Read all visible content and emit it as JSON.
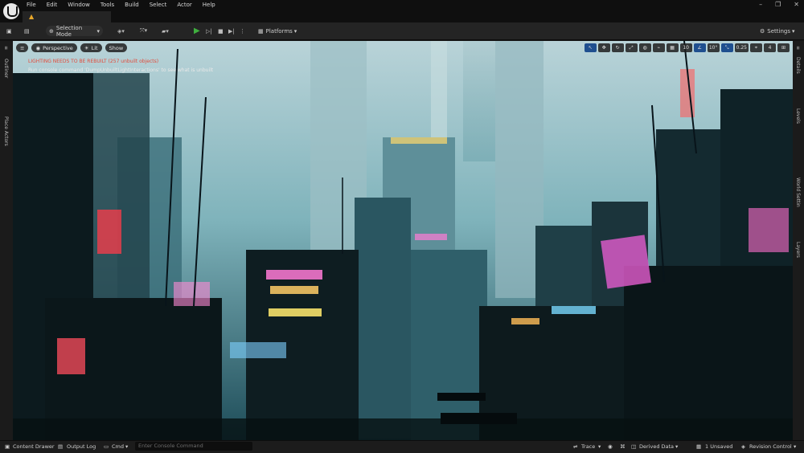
{
  "menu": {
    "items": [
      "File",
      "Edit",
      "Window",
      "Tools",
      "Build",
      "Select",
      "Actor",
      "Help"
    ]
  },
  "toolbar": {
    "selection_mode": "Selection Mode",
    "platforms": "Platforms",
    "settings": "Settings"
  },
  "viewport": {
    "perspective": "Perspective",
    "lit": "Lit",
    "show": "Show",
    "grid_angle": "10°",
    "camera_speed": "0.25",
    "viewports": "4",
    "snap_value": "10",
    "message_warning": "LIGHTING NEEDS TO BE REBUILT (257 unbuilt objects)",
    "message_info": "Run console command 'DumpUnbuiltLightInteractions' to see what is unbuilt"
  },
  "sidebars": {
    "left": [
      "Outliner",
      "Place Actors"
    ],
    "right": [
      "Details",
      "Levels",
      "World Settin",
      "Layers"
    ]
  },
  "statusbar": {
    "content_drawer": "Content Drawer",
    "output_log": "Output Log",
    "cmd": "Cmd",
    "console_placeholder": "Enter Console Command",
    "trace": "Trace",
    "derived_data": "Derived Data",
    "unsaved": "1 Unsaved",
    "revision_control": "Revision Control"
  },
  "colors": {
    "accent_play": "#3fb13f",
    "warning": "#e8a72a",
    "error_text": "#e24a3a"
  }
}
